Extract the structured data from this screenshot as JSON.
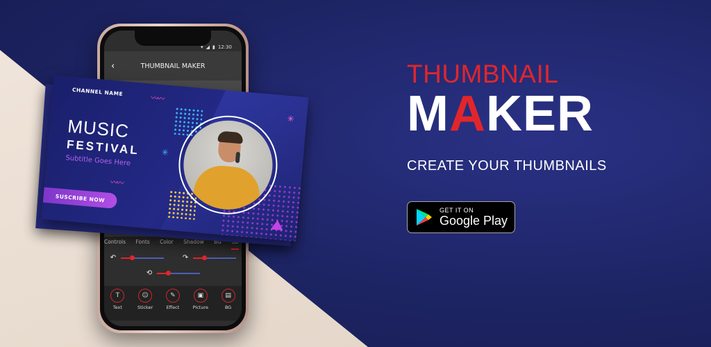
{
  "phone": {
    "status_time": "12:30",
    "app_title": "THUMBNAIL MAKER",
    "tabs": [
      "Controls",
      "Fonts",
      "Color",
      "Shadow",
      "BG",
      "3D"
    ],
    "active_tab": "3D",
    "sliders": {
      "rotate_left": 0.25,
      "rotate_right": 0.25,
      "flip": 0.25
    },
    "tools": [
      {
        "label": "Text",
        "icon": "text-icon"
      },
      {
        "label": "Sticker",
        "icon": "sticker-icon"
      },
      {
        "label": "Effect",
        "icon": "effect-icon"
      },
      {
        "label": "Picture",
        "icon": "picture-icon"
      },
      {
        "label": "BG",
        "icon": "background-icon"
      }
    ]
  },
  "thumbnail": {
    "channel": "CHANNEL NAME",
    "title_line1": "MUSIC",
    "title_line2": "FESTIVAL",
    "subtitle": "Subtitle Goes Here",
    "cta": "SUSCRIBE NOW"
  },
  "promo": {
    "title_top": "THUMBNAIL",
    "title_main_a": "M",
    "title_main_b": "A",
    "title_main_c": "KER",
    "tagline": "CREATE YOUR THUMBNAILS",
    "store_small": "GET IT ON",
    "store_big": "Google Play"
  },
  "colors": {
    "accent_red": "#e1262b",
    "navy": "#1e2466",
    "purple": "#b24ee6"
  }
}
